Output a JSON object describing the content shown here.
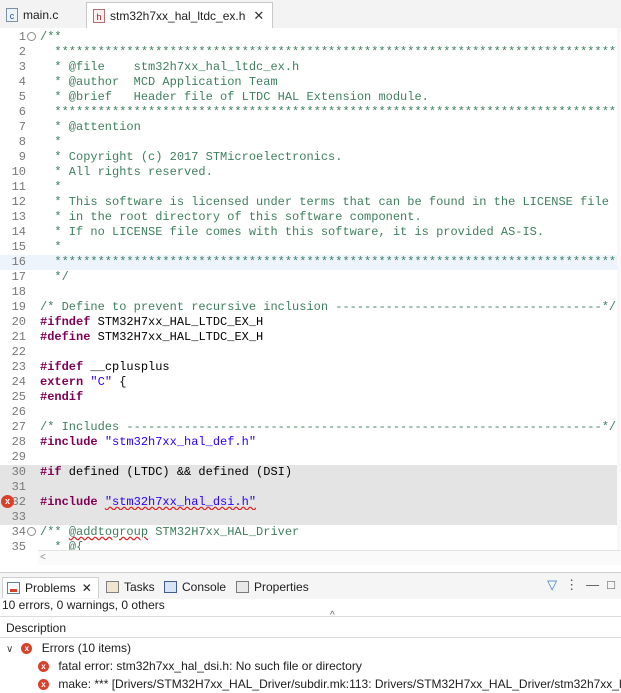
{
  "editor_tabs": [
    {
      "label": "main.c",
      "icon": "c-file-icon"
    },
    {
      "label": "stm32h7xx_hal_ltdc_ex.h",
      "icon": "h-file-icon",
      "close": "✕"
    }
  ],
  "code_lines": [
    {
      "n": "1",
      "segs": [
        {
          "t": "/**",
          "c": "cm"
        }
      ],
      "fold": "⊖"
    },
    {
      "n": "2",
      "segs": [
        {
          "t": "  ******************************************************************************",
          "c": "cm"
        }
      ]
    },
    {
      "n": "3",
      "segs": [
        {
          "t": "  * @file    stm32h7xx_hal_ltdc_ex.h",
          "c": "cm"
        }
      ]
    },
    {
      "n": "4",
      "segs": [
        {
          "t": "  * @author  MCD Application Team",
          "c": "cm"
        }
      ]
    },
    {
      "n": "5",
      "segs": [
        {
          "t": "  * @brief   Header file of LTDC HAL Extension module.",
          "c": "cm"
        }
      ]
    },
    {
      "n": "6",
      "segs": [
        {
          "t": "  ******************************************************************************",
          "c": "cm"
        }
      ]
    },
    {
      "n": "7",
      "segs": [
        {
          "t": "  * @attention",
          "c": "cm"
        }
      ]
    },
    {
      "n": "8",
      "segs": [
        {
          "t": "  *",
          "c": "cm"
        }
      ]
    },
    {
      "n": "9",
      "segs": [
        {
          "t": "  * Copyright (c) 2017 STMicroelectronics.",
          "c": "cm"
        }
      ]
    },
    {
      "n": "10",
      "segs": [
        {
          "t": "  * All rights reserved.",
          "c": "cm"
        }
      ]
    },
    {
      "n": "11",
      "segs": [
        {
          "t": "  *",
          "c": "cm"
        }
      ]
    },
    {
      "n": "12",
      "segs": [
        {
          "t": "  * This software is licensed under terms that can be found in the LICENSE file",
          "c": "cm"
        }
      ]
    },
    {
      "n": "13",
      "segs": [
        {
          "t": "  * in the root directory of this software component.",
          "c": "cm"
        }
      ]
    },
    {
      "n": "14",
      "segs": [
        {
          "t": "  * If no LICENSE file comes with this software, it is provided AS-IS.",
          "c": "cm"
        }
      ]
    },
    {
      "n": "15",
      "segs": [
        {
          "t": "  *",
          "c": "cm"
        }
      ]
    },
    {
      "n": "16",
      "segs": [
        {
          "t": "  ******************************************************************************",
          "c": "cm"
        }
      ],
      "bg": "#eef4fb"
    },
    {
      "n": "17",
      "segs": [
        {
          "t": "  */",
          "c": "cm"
        }
      ]
    },
    {
      "n": "18",
      "segs": []
    },
    {
      "n": "19",
      "segs": [
        {
          "t": "/* Define to prevent recursive inclusion -------------------------------------*/",
          "c": "cm"
        }
      ]
    },
    {
      "n": "20",
      "segs": [
        {
          "t": "#ifndef",
          "c": "kw"
        },
        {
          "t": " STM32H7xx_HAL_LTDC_EX_H",
          "c": ""
        }
      ]
    },
    {
      "n": "21",
      "segs": [
        {
          "t": "#define",
          "c": "kw"
        },
        {
          "t": " STM32H7xx_HAL_LTDC_EX_H",
          "c": ""
        }
      ]
    },
    {
      "n": "22",
      "segs": []
    },
    {
      "n": "23",
      "segs": [
        {
          "t": "#ifdef",
          "c": "kw"
        },
        {
          "t": " __cplusplus",
          "c": ""
        }
      ]
    },
    {
      "n": "24",
      "segs": [
        {
          "t": "extern",
          "c": "kw"
        },
        {
          "t": " ",
          "c": ""
        },
        {
          "t": "\"C\"",
          "c": "str"
        },
        {
          "t": " {",
          "c": ""
        }
      ]
    },
    {
      "n": "25",
      "segs": [
        {
          "t": "#endif",
          "c": "kw"
        }
      ]
    },
    {
      "n": "26",
      "segs": []
    },
    {
      "n": "27",
      "segs": [
        {
          "t": "/* Includes ------------------------------------------------------------------*/",
          "c": "cm"
        }
      ]
    },
    {
      "n": "28",
      "segs": [
        {
          "t": "#include",
          "c": "kw"
        },
        {
          "t": " ",
          "c": ""
        },
        {
          "t": "\"stm32h7xx_hal_def.h\"",
          "c": "str"
        }
      ]
    },
    {
      "n": "29",
      "segs": []
    },
    {
      "n": "30",
      "segs": [
        {
          "t": "#if",
          "c": "kw"
        },
        {
          "t": " defined (LTDC) && defined (DSI)",
          "c": ""
        }
      ],
      "hl": true
    },
    {
      "n": "31",
      "segs": [],
      "hl": true
    },
    {
      "n": "32",
      "segs": [
        {
          "t": "#include",
          "c": "kw"
        },
        {
          "t": " ",
          "c": ""
        },
        {
          "t": "\"stm32h7xx_hal_dsi.h\"",
          "c": "str err"
        }
      ],
      "hl": true,
      "error": true
    },
    {
      "n": "33",
      "segs": [],
      "hl": true
    },
    {
      "n": "34",
      "segs": [
        {
          "t": "/** ",
          "c": "cm"
        },
        {
          "t": "@addtogroup",
          "c": "cm err"
        },
        {
          "t": " STM32H7xx_HAL_Driver",
          "c": "cm"
        }
      ],
      "fold": "⊖"
    },
    {
      "n": "35",
      "segs": [
        {
          "t": "  * @{",
          "c": "cm"
        }
      ]
    }
  ],
  "panel": {
    "tabs": [
      {
        "label": "Problems",
        "icon": "problems-icon",
        "close": "✕"
      },
      {
        "label": "Tasks",
        "icon": "tasks-icon"
      },
      {
        "label": "Console",
        "icon": "console-icon"
      },
      {
        "label": "Properties",
        "icon": "properties-icon"
      }
    ],
    "toolbar": [
      "filter-icon",
      "view-menu-icon",
      "minimize-icon",
      "maximize-icon"
    ],
    "summary": "10 errors, 0 warnings, 0 others",
    "column_header": "Description",
    "group_label": "Errors (10 items)",
    "error_rows": [
      "fatal error: stm32h7xx_hal_dsi.h: No such file or directory",
      "make: *** [Drivers/STM32H7xx_HAL_Driver/subdir.mk:113: Drivers/STM32H7xx_HAL_Driver/stm32h7xx_hal"
    ]
  }
}
